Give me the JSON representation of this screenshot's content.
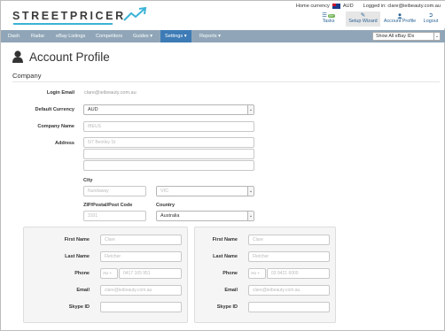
{
  "header": {
    "logo_text": "STREETPRICER",
    "home_currency_label": "Home currency",
    "home_currency_value": "AUD",
    "logged_in_text": "Logged in: clare@ieibeauty.com.au",
    "links": [
      {
        "label": "Tasks",
        "icon": "tasks-icon",
        "badge": "99+"
      },
      {
        "label": "Setup Wizard",
        "icon": "wizard-icon"
      },
      {
        "label": "Account Profile",
        "icon": "user-icon"
      },
      {
        "label": "Logout",
        "icon": "logout-icon"
      }
    ]
  },
  "nav": {
    "items": [
      "Dash",
      "Radar",
      "eBay Listings",
      "Competitors",
      "Guides ▾",
      "Settings ▾",
      "Reports ▾"
    ],
    "active": "Settings",
    "ebay_select": "Show All eBay IDs"
  },
  "page": {
    "title": "Account Profile",
    "section": "Company"
  },
  "form": {
    "login_email_label": "Login Email",
    "login_email_value": "clare@ieibeauty.com.au",
    "currency_label": "Default Currency",
    "currency_value": "AUD",
    "company_label": "Company Name",
    "company_value": "IBEUS",
    "address_label": "Address",
    "address_line1": "5/7 Bentley St",
    "address_line2": "",
    "address_line3": "",
    "city_label": "City",
    "city_value": "Nundaway",
    "state_value": "VIC",
    "zip_label": "ZIP/Postal/Post Code",
    "zip_value": "3101",
    "country_label": "Country",
    "country_value": "Australia"
  },
  "contacts": [
    {
      "first_name_label": "First Name",
      "first_name": "Clare",
      "last_name_label": "Last Name",
      "last_name": "Fletcher",
      "phone_label": "Phone",
      "phone_prefix": "AU +",
      "phone": "0417 165 951",
      "email_label": "Email",
      "email": "clare@ieibeauty.com.au",
      "skype_label": "Skype ID",
      "skype": ""
    },
    {
      "first_name_label": "First Name",
      "first_name": "Clare",
      "last_name_label": "Last Name",
      "last_name": "Fletcher",
      "phone_label": "Phone",
      "phone_prefix": "AU +",
      "phone": "03 9421 6000",
      "email_label": "Email",
      "email": "clare@ieibeauty.com.au",
      "skype_label": "Skype ID",
      "skype": ""
    }
  ],
  "colors": {
    "nav_bg": "#90a6b8",
    "nav_active": "#3d7bb6",
    "logo_accent": "#3bb3d7",
    "link": "#2a6496"
  }
}
